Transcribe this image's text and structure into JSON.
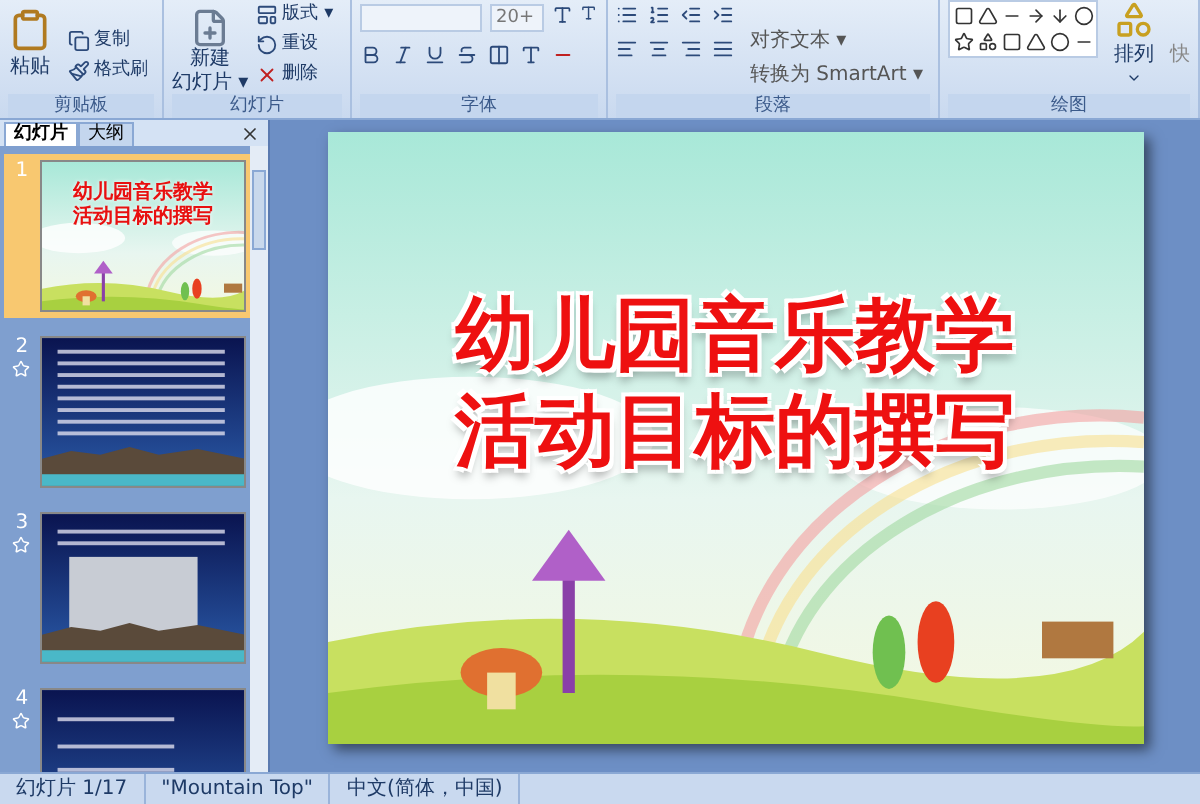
{
  "ribbon": {
    "groups": [
      {
        "kind": "clipboard",
        "label": "剪贴板",
        "big": "粘贴",
        "items": [
          "复制",
          "格式刷"
        ]
      },
      {
        "kind": "slides",
        "label": "幻灯片",
        "big_lines": [
          "新建",
          "幻灯片 ▾"
        ],
        "items": [
          "版式 ▾",
          "重设",
          "删除"
        ]
      },
      {
        "kind": "font",
        "label": "字体",
        "font_size": "20+"
      },
      {
        "kind": "paragraph",
        "label": "段落",
        "items": [
          "对齐文本 ▾",
          "转换为 SmartArt ▾"
        ]
      },
      {
        "kind": "drawing",
        "label": "绘图",
        "big": "排列",
        "extra": "快"
      }
    ]
  },
  "panel": {
    "tabs": [
      {
        "label": "幻灯片",
        "selected": true
      },
      {
        "label": "大纲",
        "selected": false
      }
    ],
    "thumbnails": [
      {
        "number": "1",
        "selected": true,
        "kind": "title",
        "has_animation": false,
        "title_lines": [
          "幼儿园音乐教学",
          "活动目标的撰写"
        ]
      },
      {
        "number": "2",
        "selected": false,
        "kind": "text",
        "has_animation": true
      },
      {
        "number": "3",
        "selected": false,
        "has_animation": true
      },
      {
        "number": "4",
        "selected": false,
        "kind": "plain",
        "has_animation": true
      }
    ]
  },
  "slide": {
    "title_lines": [
      "幼儿园音乐教学",
      "活动目标的撰写"
    ]
  },
  "status_bar": [
    "幻灯片 1/17",
    "\"Mountain Top\"",
    "中文(简体，中国)"
  ]
}
